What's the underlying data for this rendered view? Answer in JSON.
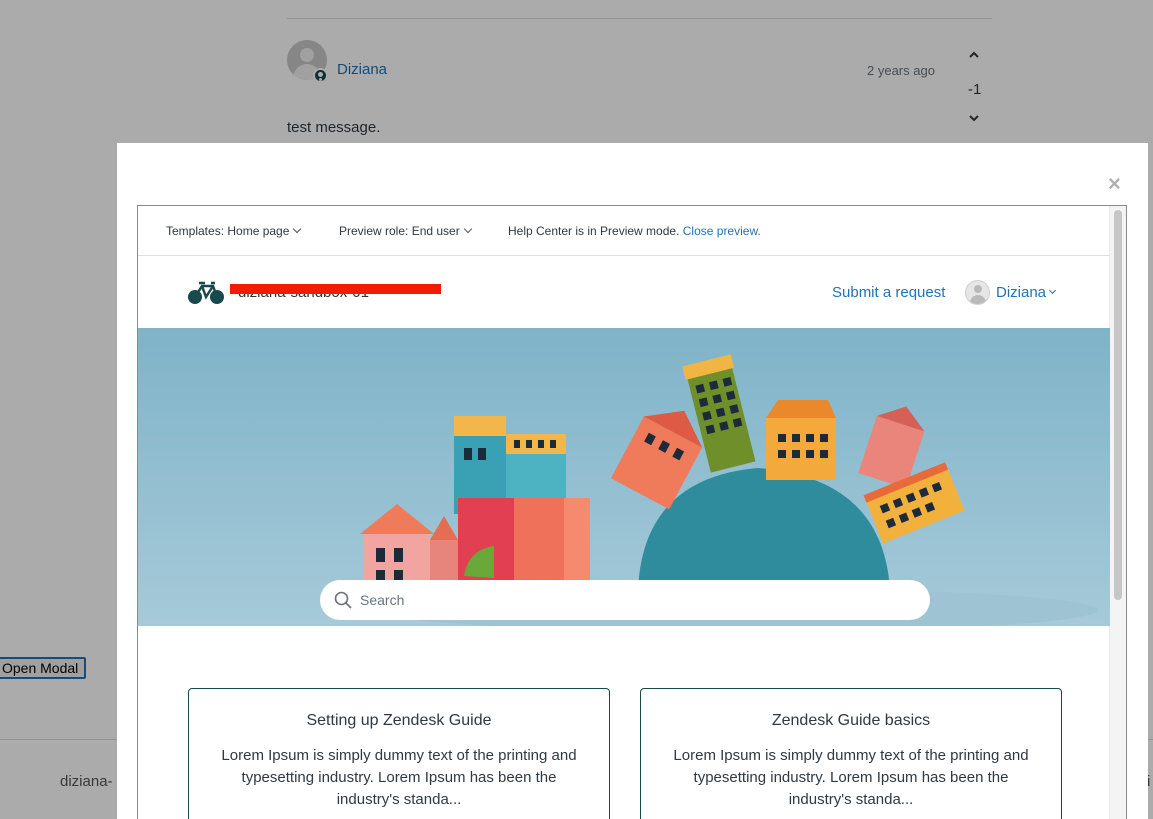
{
  "background_page": {
    "comment": {
      "author": "Diziana",
      "time": "2 years ago",
      "vote_up_icon": "chevron-up-icon",
      "vote_count": "-1",
      "vote_down_icon": "chevron-down-icon",
      "body": "test message."
    },
    "open_modal_label": "Open Modal",
    "footer_text": "diziana-",
    "footer_right_text": "i"
  },
  "modal": {
    "close_label": "×",
    "preview_bar": {
      "templates": "Templates: Home page",
      "preview_role": "Preview role: End user",
      "mode_text": "Help Center is in Preview mode.",
      "close_preview": "Close preview."
    },
    "header": {
      "brand_name": "diziana-sandbox-01",
      "submit_request": "Submit a request",
      "user_name": "Diziana"
    },
    "search": {
      "placeholder": "Search"
    },
    "cards": [
      {
        "title": "Setting up Zendesk Guide",
        "description": "Lorem Ipsum is simply dummy text of the printing and typesetting industry. Lorem Ipsum has been the industry's standa..."
      },
      {
        "title": "Zendesk Guide basics",
        "description": "Lorem Ipsum is simply dummy text of the printing and typesetting industry. Lorem Ipsum has been the industry's standa..."
      }
    ]
  },
  "colors": {
    "link": "#1f73b7",
    "redaction": "#f31b00",
    "card_border": "#17494d"
  }
}
